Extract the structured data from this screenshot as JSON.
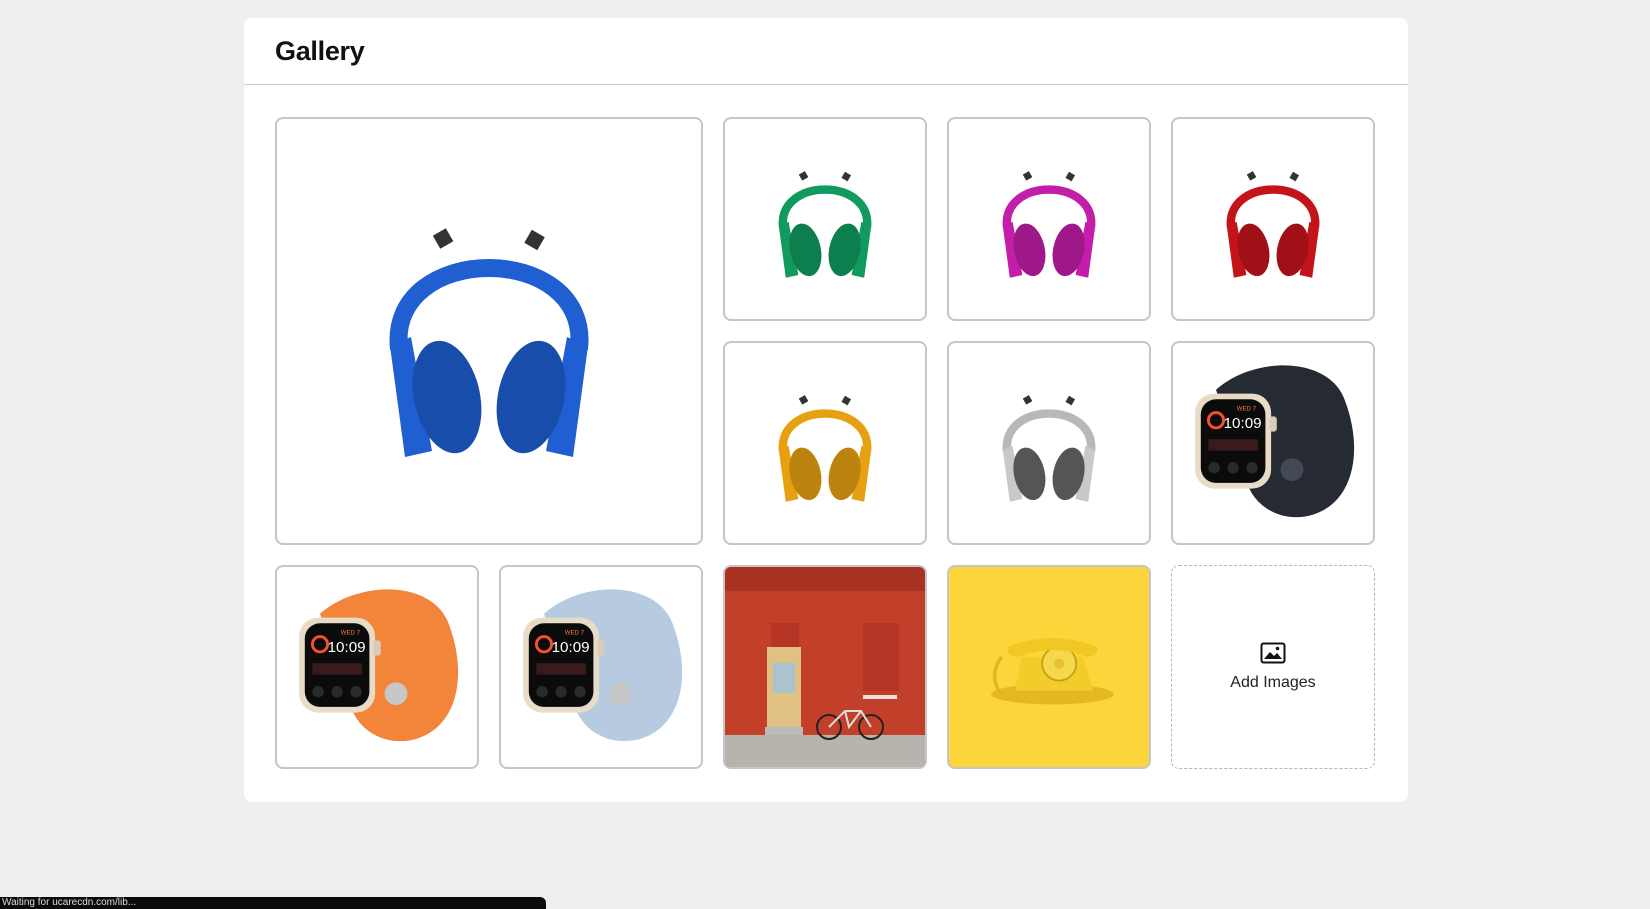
{
  "gallery": {
    "title": "Gallery",
    "add_label": "Add Images",
    "add_icon": "image-icon",
    "items": [
      {
        "kind": "headphones",
        "color": "#1f5fd1"
      },
      {
        "kind": "headphones",
        "color": "#109a5e"
      },
      {
        "kind": "headphones",
        "color": "#c21ea9"
      },
      {
        "kind": "headphones",
        "color": "#c4141b"
      },
      {
        "kind": "headphones",
        "color": "#e6a012"
      },
      {
        "kind": "headphones",
        "color": "#b8b8b8"
      },
      {
        "kind": "watch",
        "color": "#262a33"
      },
      {
        "kind": "watch",
        "color": "#f3853b"
      },
      {
        "kind": "watch",
        "color": "#b6cbe0"
      },
      {
        "kind": "photo-door-bicycle"
      },
      {
        "kind": "photo-yellow-telephone"
      }
    ]
  },
  "watch_face": {
    "day": "WED 7",
    "time": "10:09"
  },
  "status_bar": {
    "text": "Waiting for ucarecdn.com/lib..."
  }
}
